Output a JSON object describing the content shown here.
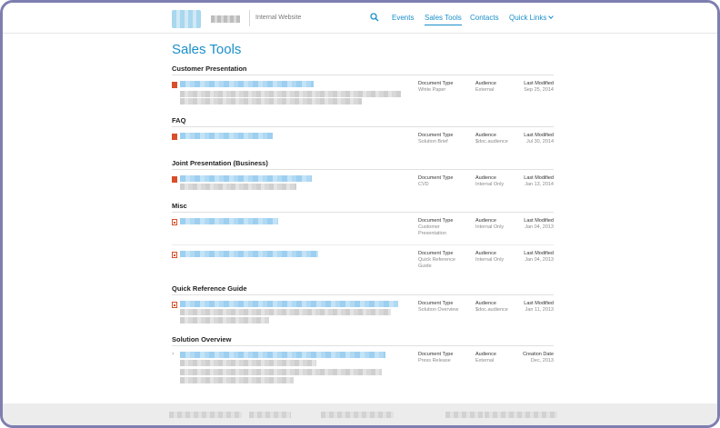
{
  "header": {
    "site_name": "Internal Website",
    "nav": {
      "events": "Events",
      "sales_tools": "Sales Tools",
      "contacts": "Contacts",
      "quick_links": "Quick Links"
    }
  },
  "page_title": "Sales Tools",
  "labels": {
    "document_type": "Document Type",
    "audience": "Audience",
    "last_modified": "Last Modified",
    "creation_date": "Creation Date"
  },
  "sections": [
    {
      "title": "Customer Presentation",
      "rows": [
        {
          "icon": "ppt-file-icon",
          "doc_type": "White Paper",
          "audience": "External",
          "date": "Sep 25, 2014"
        }
      ]
    },
    {
      "title": "FAQ",
      "rows": [
        {
          "icon": "ppt-file-icon",
          "doc_type": "Solution Brief",
          "audience": "$doc.audience",
          "date": "Jul 30, 2014"
        }
      ]
    },
    {
      "title": "Joint Presentation (Business)",
      "rows": [
        {
          "icon": "ppt-file-icon",
          "doc_type": "CVD",
          "audience": "Internal Only",
          "date": "Jan 13, 2014"
        }
      ]
    },
    {
      "title": "Misc",
      "rows": [
        {
          "icon": "pdf-file-icon",
          "doc_type": "Customer Presentation",
          "audience": "Internal Only",
          "date": "Jan 04, 2013"
        },
        {
          "icon": "pdf-file-icon",
          "doc_type": "Quick Reference Guide",
          "audience": "Internal Only",
          "date": "Jan 04, 2013"
        }
      ]
    },
    {
      "title": "Quick Reference Guide",
      "rows": [
        {
          "icon": "pdf-file-icon",
          "doc_type": "Solution Overview",
          "audience": "$doc.audience",
          "date": "Jan 11, 2013"
        }
      ]
    },
    {
      "title": "Solution Overview",
      "rows": [
        {
          "icon": "chevron-right-icon",
          "doc_type": "Press Release",
          "audience": "External",
          "date": "Dec, 2013"
        }
      ]
    }
  ],
  "colors": {
    "accent": "#1a8fc9",
    "file_icon": "#d84f29",
    "frame": "#7f7eb0"
  }
}
